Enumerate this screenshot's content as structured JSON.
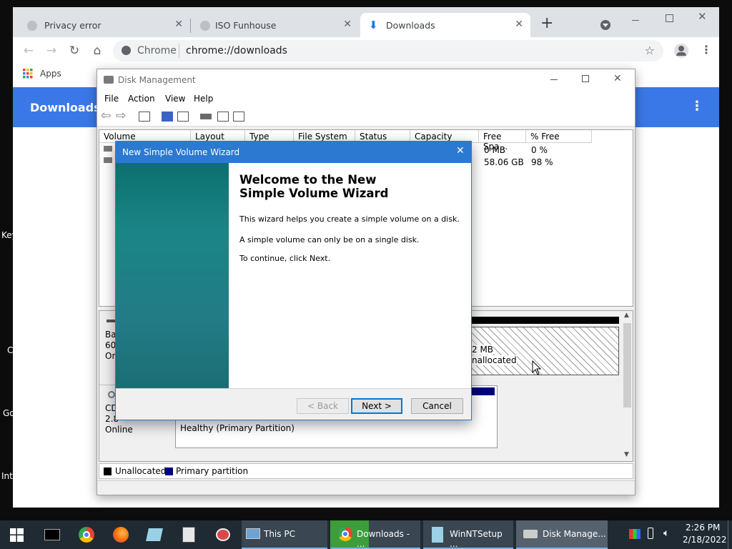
{
  "desktop": {
    "labels": [
      "Key",
      "C",
      "Go",
      "Int"
    ]
  },
  "chrome": {
    "tabs": [
      {
        "title": "Privacy error"
      },
      {
        "title": "ISO Funhouse"
      },
      {
        "title": "Downloads"
      }
    ],
    "new_tab_symbol": "+",
    "omnibox": {
      "scheme_label": "Chrome",
      "url": "chrome://downloads"
    },
    "bookmarks": {
      "apps_label": "Apps"
    },
    "page_title": "Downloads"
  },
  "disk_management": {
    "title": "Disk Management",
    "menu": [
      "File",
      "Action",
      "View",
      "Help"
    ],
    "columns": [
      "Volume",
      "Layout",
      "Type",
      "File System",
      "Status",
      "Capacity",
      "Free Spa...",
      "% Free"
    ],
    "rows": [
      {
        "free_space": "0 MB",
        "pct_free": "0 %"
      },
      {
        "free_space": "58.06 GB",
        "pct_free": "98 %"
      }
    ],
    "disk0": {
      "line1": "Ba",
      "line2": "60.",
      "line3": "On"
    },
    "disk0_unalloc": {
      "size": "2 MB",
      "label": "nallocated"
    },
    "cdrom": {
      "line1": "CD",
      "line2": "2.8",
      "line3": "Online"
    },
    "cdrom_partition": {
      "status": "Healthy (Primary Partition)"
    },
    "legend": {
      "unallocated": "Unallocated",
      "primary": "Primary partition"
    },
    "colors": {
      "unallocated": "#000000",
      "primary": "#00007f"
    }
  },
  "wizard": {
    "title": "New Simple Volume Wizard",
    "heading": "Welcome to the New Simple Volume Wizard",
    "para1": "This wizard helps you create a simple volume on a disk.",
    "para2": "A simple volume can only be on a single disk.",
    "para3": "To continue, click Next.",
    "back_label": "< Back",
    "next_label": "Next >",
    "cancel_label": "Cancel"
  },
  "taskbar": {
    "items": [
      {
        "label": "This PC"
      },
      {
        "label": "Downloads - ..."
      },
      {
        "label": "WinNTSetup ..."
      },
      {
        "label": "Disk Manage..."
      }
    ],
    "time": "2:26 PM",
    "date": "2/18/2022"
  }
}
